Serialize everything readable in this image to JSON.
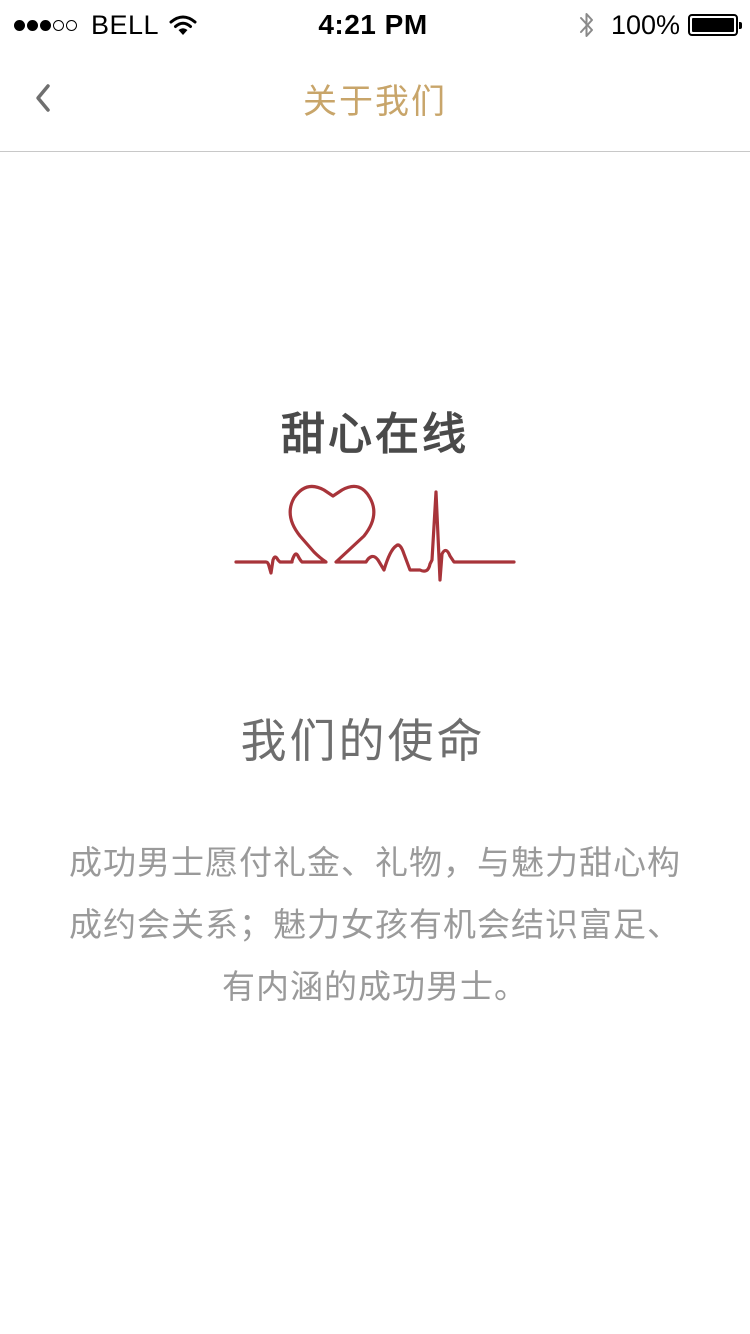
{
  "status_bar": {
    "carrier": "BELL",
    "time": "4:21 PM",
    "battery_percent": "100%",
    "battery_level": 1.0,
    "signal_strength": 3,
    "signal_max": 5,
    "icons": [
      "wifi-icon",
      "bluetooth-icon",
      "battery-icon"
    ]
  },
  "nav": {
    "title": "关于我们",
    "back_icon": "chevron-left-icon"
  },
  "brand": {
    "name": "甜心在线",
    "logo_icon": "heartbeat-heart-icon"
  },
  "mission": {
    "heading": "我们的使命",
    "body": "成功男士愿付礼金、礼物，与魅力甜心构成约会关系；魅力女孩有机会结识富足、有内涵的成功男士。"
  },
  "colors": {
    "nav_title": "#c8a56a",
    "logo_red": "#a8343a",
    "brand_text": "#4a4a4a",
    "heading_text": "#6e6e6e",
    "body_text": "#9a9a9a",
    "divider": "#c8c8c8"
  }
}
